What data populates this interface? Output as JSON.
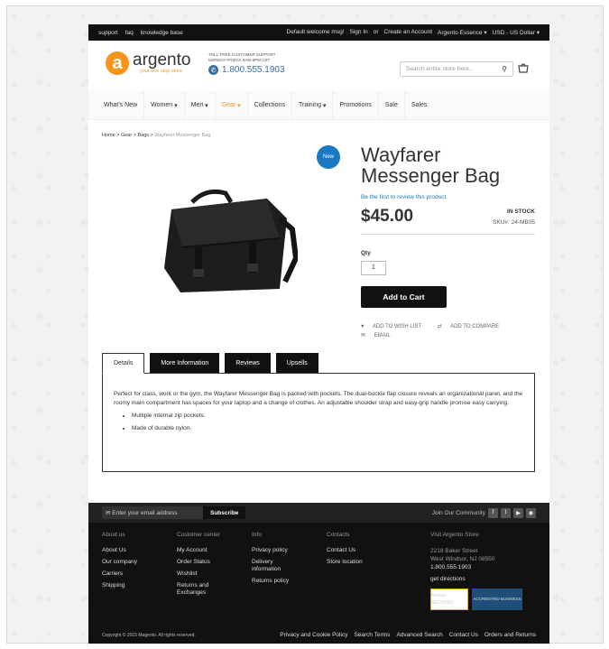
{
  "topbar": {
    "left_links": [
      "support",
      "faq",
      "knowledge base"
    ],
    "welcome": "Default welcome msg!",
    "sign_in": "Sign In",
    "or": "or",
    "create_account": "Create an Account",
    "store": "Argento Essence",
    "currency": "USD - US Dollar"
  },
  "header": {
    "logo_name": "argento",
    "logo_tagline": "your one stop store",
    "support_label": "Toll-free customer support Monday-Friday 8am-9pm CST",
    "phone": "1.800.555.1903",
    "search_placeholder": "Search entire store here..."
  },
  "nav": {
    "items": [
      {
        "label": "What's New"
      },
      {
        "label": "Women"
      },
      {
        "label": "Men"
      },
      {
        "label": "Gear"
      },
      {
        "label": "Collections"
      },
      {
        "label": "Training"
      },
      {
        "label": "Promotions"
      },
      {
        "label": "Sale"
      },
      {
        "label": "Sales"
      }
    ]
  },
  "breadcrumbs": {
    "home": "Home",
    "gear": "Gear",
    "bags": "Bags",
    "current": "Wayfarer Messenger Bag"
  },
  "product": {
    "badge": "New",
    "title": "Wayfarer Messenger Bag",
    "review_link": "Be the first to review this product",
    "price": "$45.00",
    "stock": "IN STOCK",
    "sku": "SKU#: 24-MB05",
    "qty_label": "Qty",
    "qty_value": "1",
    "add_to_cart": "Add to Cart",
    "wishlist": "Add to Wish List",
    "compare": "Add to Compare",
    "email": "Email"
  },
  "tabs": {
    "labels": [
      "Details",
      "More Information",
      "Reviews",
      "Upsells"
    ],
    "details_text": "Perfect for class, work or the gym, the Wayfarer Messenger Bag is packed with pockets. The dual-buckle flap closure reveals an organizational panel, and the roomy main compartment has spaces for your laptop and a change of clothes. An adjustable shoulder strap and easy-grip handle promise easy carrying.",
    "bullets": [
      "Multiple internal zip pockets.",
      "Made of durable nylon."
    ]
  },
  "newsletter": {
    "placeholder": "Enter your email address",
    "subscribe": "Subscribe",
    "community": "Join Our Community"
  },
  "footer": {
    "about_title": "About us",
    "about_links": [
      "About Us",
      "Our company",
      "Carriers",
      "Shipping"
    ],
    "customer_title": "Customer center",
    "customer_links": [
      "My Account",
      "Order Status",
      "Wishlist",
      "Returns and Exchanges"
    ],
    "info_title": "Info",
    "info_links": [
      "Privacy policy",
      "Delivery information",
      "Returns policy"
    ],
    "contacts_title": "Contacts",
    "contacts_links": [
      "Contact Us",
      "Store location"
    ],
    "visit_title": "Visit Argento Store",
    "address1": "2218 Baker Street",
    "address2": "West Windsor, NJ 08550",
    "phone": "1.800.555.1903",
    "directions": "get directions",
    "norton": "Norton SECURED",
    "bbb": "ACCREDITED BUSINESS",
    "copyright": "Copyright © 2015 Magento. All rights reserved.",
    "bottom_links": [
      "Privacy and Cookie Policy",
      "Search Terms",
      "Advanced Search",
      "Contact Us",
      "Orders and Returns"
    ]
  },
  "colors": {
    "accent": "#f7941d",
    "link": "#1979c3",
    "dark": "#111111"
  }
}
